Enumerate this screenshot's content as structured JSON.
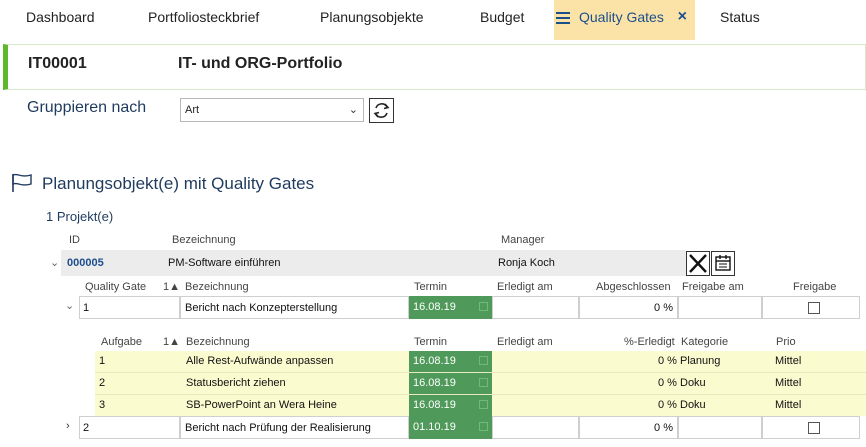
{
  "tabs": [
    {
      "label": "Dashboard"
    },
    {
      "label": "Portfoliosteckbrief"
    },
    {
      "label": "Planungsobjekte"
    },
    {
      "label": "Budget"
    },
    {
      "label": "Quality Gates"
    },
    {
      "label": "Status"
    }
  ],
  "header": {
    "id": "IT00001",
    "title": "IT- und ORG-Portfolio"
  },
  "group": {
    "label": "Gruppieren nach",
    "selected": "Art"
  },
  "section": {
    "title": "Planungsobjekt(e) mit Quality Gates",
    "count": "1 Projekt(e)"
  },
  "project_columns": {
    "id": "ID",
    "name": "Bezeichnung",
    "manager": "Manager"
  },
  "project": {
    "id": "000005",
    "name": "PM-Software einführen",
    "manager": "Ronja Koch"
  },
  "gate_columns": {
    "gate": "Quality Gate",
    "sort": "1▲",
    "name": "Bezeichnung",
    "termin": "Termin",
    "done": "Erledigt am",
    "closed": "Abgeschlossen",
    "release_on": "Freigabe am",
    "release": "Freigabe"
  },
  "gates": [
    {
      "num": "1",
      "name": "Bericht nach Konzepterstellung",
      "termin": "16.08.19",
      "closed": "0 %"
    },
    {
      "num": "2",
      "name": "Bericht nach Prüfung der Realisierung",
      "termin": "01.10.19",
      "closed": "0 %"
    }
  ],
  "task_columns": {
    "task": "Aufgabe",
    "sort": "1▲",
    "name": "Bezeichnung",
    "termin": "Termin",
    "done": "Erledigt am",
    "pct": "%-Erledigt",
    "category": "Kategorie",
    "prio": "Prio"
  },
  "tasks": [
    {
      "num": "1",
      "name": "Alle Rest-Aufwände anpassen",
      "termin": "16.08.19",
      "pct": "0 %",
      "category": "Planung",
      "prio": "Mittel"
    },
    {
      "num": "2",
      "name": "Statusbericht ziehen",
      "termin": "16.08.19",
      "pct": "0 %",
      "category": "Doku",
      "prio": "Mittel"
    },
    {
      "num": "3",
      "name": "SB-PowerPoint an Wera Heine",
      "termin": "16.08.19",
      "pct": "0 %",
      "category": "Doku",
      "prio": "Mittel"
    }
  ],
  "colors": {
    "accent": "#5fb82a",
    "active_tab": "#fbe3a8",
    "termin": "#4f9a5a",
    "task_row": "#fbfbd0",
    "link": "#1b4f8c"
  }
}
